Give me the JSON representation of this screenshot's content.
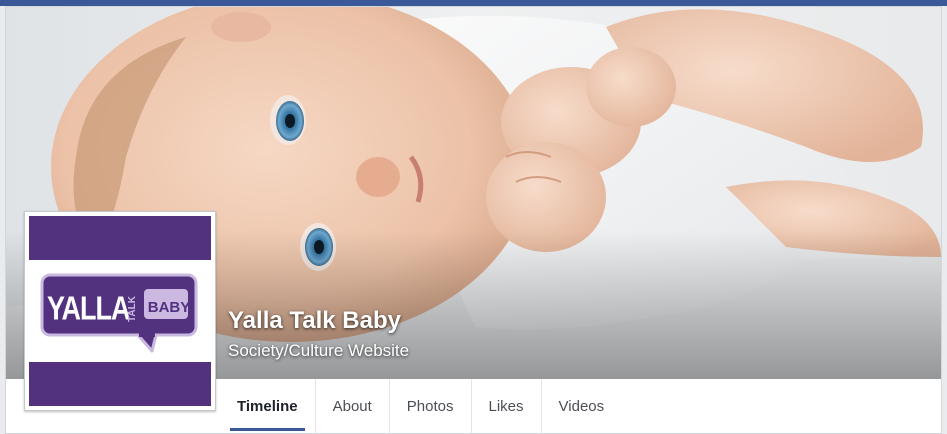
{
  "page": {
    "name": "Yalla Talk Baby",
    "category": "Society/Culture Website"
  },
  "profile": {
    "logo_word_1": "YALLA",
    "logo_word_2": "TALK",
    "logo_word_3": "BABY",
    "brand_color": "#52317f"
  },
  "cover": {
    "description_icon": "baby-photo"
  },
  "tabs": [
    {
      "label": "Timeline",
      "active": true
    },
    {
      "label": "About",
      "active": false
    },
    {
      "label": "Photos",
      "active": false
    },
    {
      "label": "Likes",
      "active": false
    },
    {
      "label": "Videos",
      "active": false
    }
  ],
  "colors": {
    "top_bar": "#3b5998",
    "tab_underline": "#3b5998"
  }
}
